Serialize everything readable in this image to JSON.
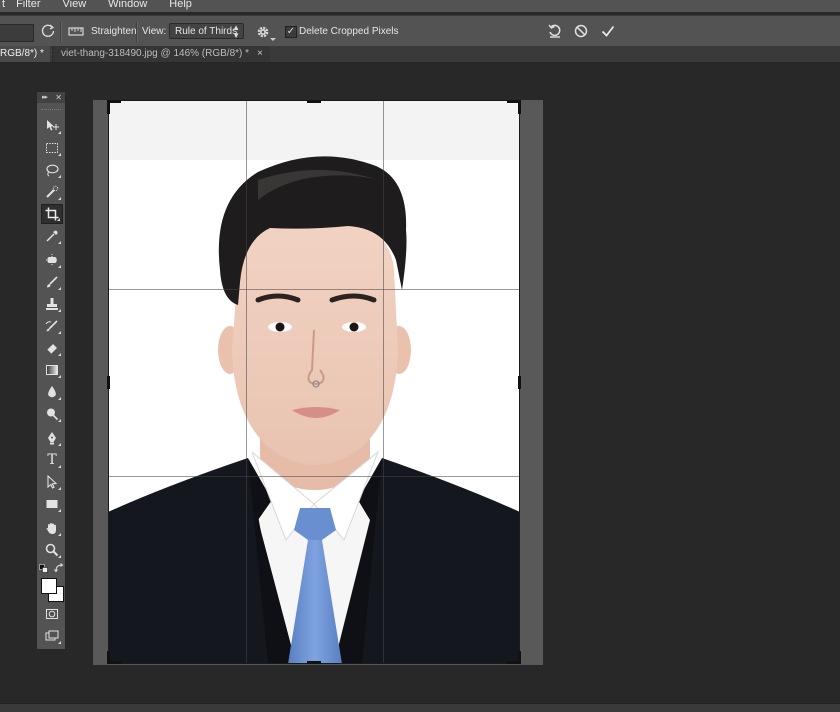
{
  "menu": {
    "items": [
      "t",
      "Filter",
      "View",
      "Window",
      "Help"
    ]
  },
  "options": {
    "straighten_label": "Straighten",
    "view_label": "View:",
    "view_value": "Rule of Thirds",
    "delete_cropped_label": "Delete Cropped Pixels",
    "delete_cropped_checked": true
  },
  "tabs": {
    "active": {
      "label": "RGB/8*) *",
      "close": "×"
    },
    "inactive": {
      "label": "viet-thang-318490.jpg @ 146% (RGB/8*) *",
      "close": "×"
    }
  },
  "tools": {
    "items": [
      {
        "name": "move-tool",
        "icon": "move-icon"
      },
      {
        "name": "marquee-tool",
        "icon": "marquee-icon"
      },
      {
        "name": "lasso-tool",
        "icon": "lasso-icon"
      },
      {
        "name": "quick-selection-tool",
        "icon": "quick-selection-icon"
      },
      {
        "name": "crop-tool",
        "icon": "crop-icon",
        "selected": true
      },
      {
        "name": "eyedropper-tool",
        "icon": "eyedropper-icon"
      },
      {
        "name": "spot-healing-tool",
        "icon": "healing-icon"
      },
      {
        "name": "brush-tool",
        "icon": "brush-icon"
      },
      {
        "name": "clone-stamp-tool",
        "icon": "stamp-icon"
      },
      {
        "name": "history-brush-tool",
        "icon": "history-brush-icon"
      },
      {
        "name": "eraser-tool",
        "icon": "eraser-icon"
      },
      {
        "name": "gradient-tool",
        "icon": "gradient-icon"
      },
      {
        "name": "blur-tool",
        "icon": "blur-icon"
      },
      {
        "name": "dodge-tool",
        "icon": "dodge-icon"
      },
      {
        "name": "pen-tool",
        "icon": "pen-icon"
      },
      {
        "name": "type-tool",
        "icon": "type-icon",
        "glyph": "T"
      },
      {
        "name": "path-selection-tool",
        "icon": "path-selection-icon"
      },
      {
        "name": "rectangle-tool",
        "icon": "rectangle-icon"
      },
      {
        "name": "hand-tool",
        "icon": "hand-icon"
      },
      {
        "name": "zoom-tool",
        "icon": "zoom-icon"
      }
    ],
    "foreground_color": "#ffffff",
    "background_color": "#ffffff"
  },
  "colors": {
    "ui_bg": "#282828",
    "panel": "#535353",
    "suit": "#14161e",
    "tie": "#6a8fd0",
    "shirt": "#f4f4f4"
  }
}
